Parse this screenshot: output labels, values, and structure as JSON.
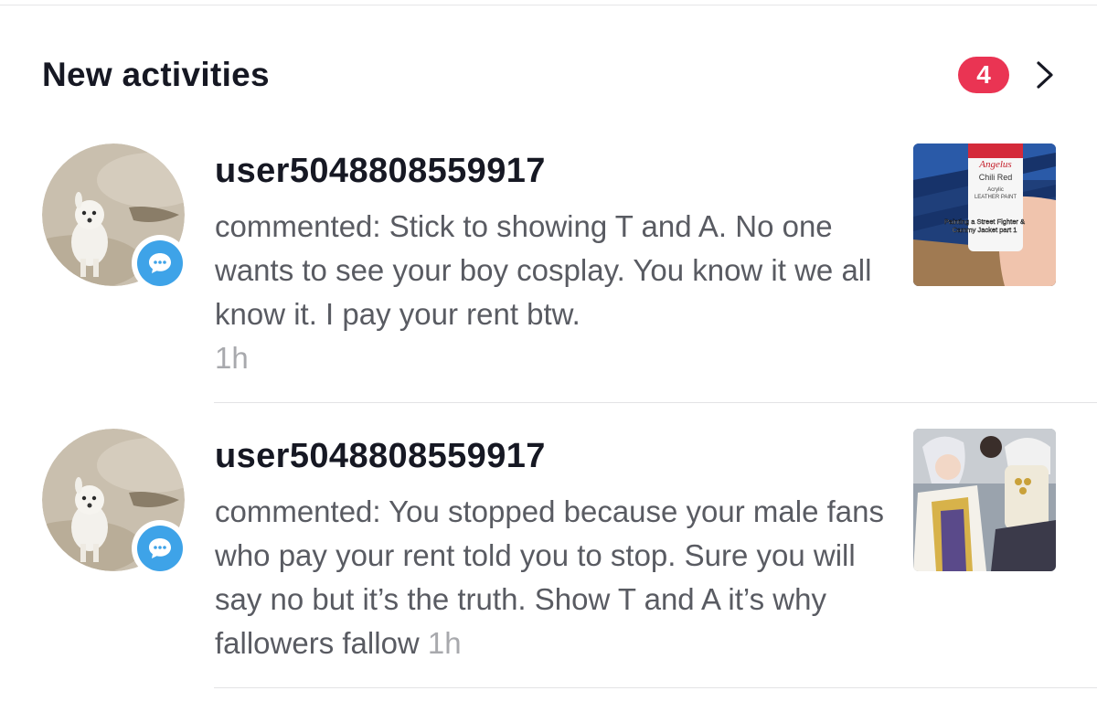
{
  "header": {
    "title": "New activities",
    "badge_count": "4",
    "chevron_icon": "chevron-right-icon"
  },
  "activities": [
    {
      "username": "user5048808559917",
      "comment": "commented: Stick to showing T and A. No one wants to see your boy cosplay. You know it we all know it. I pay your rent btw.",
      "time": "1h",
      "badge_icon": "comment-icon",
      "thumbnail": {
        "caption_line1": "Painting a Street Fighter &",
        "caption_line2": "Cammy Jacket part 1",
        "brand": "Angelus",
        "color_name": "Chili Red",
        "product_line1": "Acrylic",
        "product_line2": "LEATHER PAINT"
      }
    },
    {
      "username": "user5048808559917",
      "comment": "commented: You stopped because your male fans who pay your rent told you to stop. Sure you will say no but it’s the truth. Show T and A it’s why fallowers fallow",
      "time": "1h",
      "badge_icon": "comment-icon"
    }
  ],
  "colors": {
    "badge_red": "#ea3453",
    "comment_blue": "#3ea3e8",
    "text_dark": "#161823",
    "text_gray": "#595b62",
    "time_gray": "#a8a9ad"
  }
}
